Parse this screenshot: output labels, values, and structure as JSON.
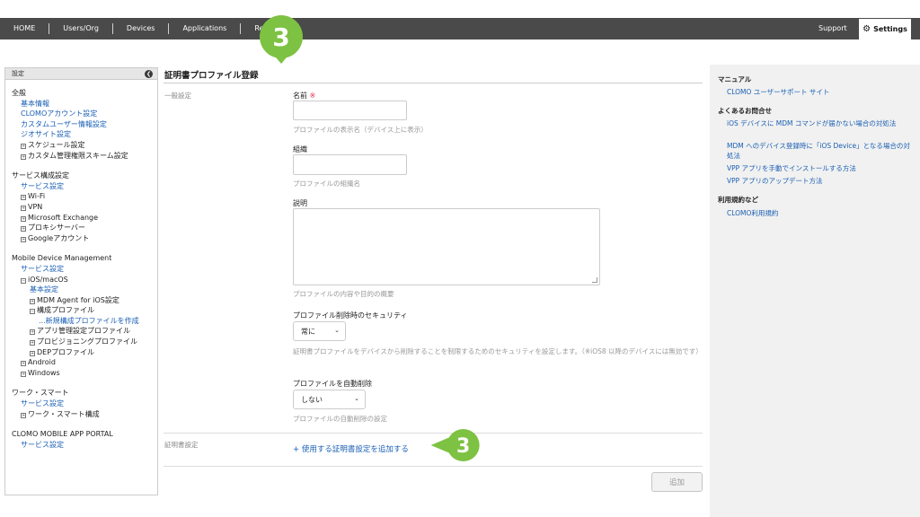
{
  "nav": {
    "items": [
      "HOME",
      "Users/Org",
      "Devices",
      "Applications",
      "Repor"
    ],
    "support": "Support",
    "settings": "Settings"
  },
  "sidebar": {
    "header": "設定",
    "sections": [
      {
        "title": "全般",
        "items": [
          {
            "label": "基本情報",
            "type": "link",
            "indent": 1
          },
          {
            "label": "CLOMOアカウント設定",
            "type": "link",
            "indent": 1
          },
          {
            "label": "カスタムユーザー情報設定",
            "type": "link",
            "indent": 1
          },
          {
            "label": "ジオサイト設定",
            "type": "link",
            "indent": 1
          },
          {
            "label": "スケジュール設定",
            "type": "plus",
            "indent": 1
          },
          {
            "label": "カスタム管理権限スキーム設定",
            "type": "plus",
            "indent": 1
          }
        ]
      },
      {
        "title": "サービス構成設定",
        "items": [
          {
            "label": "サービス設定",
            "type": "link",
            "indent": 1
          },
          {
            "label": "Wi-Fi",
            "type": "plus",
            "indent": 1
          },
          {
            "label": "VPN",
            "type": "plus",
            "indent": 1
          },
          {
            "label": "Microsoft Exchange",
            "type": "plus",
            "indent": 1
          },
          {
            "label": "プロキシサーバー",
            "type": "plus",
            "indent": 1
          },
          {
            "label": "Googleアカウント",
            "type": "plus",
            "indent": 1
          }
        ]
      },
      {
        "title": "Mobile Device Management",
        "items": [
          {
            "label": "サービス設定",
            "type": "link",
            "indent": 1
          },
          {
            "label": "iOS/macOS",
            "type": "minus",
            "indent": 1
          },
          {
            "label": "基本設定",
            "type": "link",
            "indent": 2
          },
          {
            "label": "MDM Agent for iOS設定",
            "type": "plus",
            "indent": 2
          },
          {
            "label": "構成プロファイル",
            "type": "minus",
            "indent": 2
          },
          {
            "label": "...新規構成プロファイルを作成",
            "type": "link",
            "indent": 3
          },
          {
            "label": "アプリ管理設定プロファイル",
            "type": "plus",
            "indent": 2
          },
          {
            "label": "プロビジョニングプロファイル",
            "type": "plus",
            "indent": 2
          },
          {
            "label": "DEPプロファイル",
            "type": "plus",
            "indent": 2
          },
          {
            "label": "Android",
            "type": "plus",
            "indent": 1
          },
          {
            "label": "Windows",
            "type": "plus",
            "indent": 1
          }
        ]
      },
      {
        "title": "ワーク・スマート",
        "items": [
          {
            "label": "サービス設定",
            "type": "link",
            "indent": 1
          },
          {
            "label": "ワーク・スマート構成",
            "type": "plus",
            "indent": 1
          }
        ]
      },
      {
        "title": "CLOMO MOBILE APP PORTAL",
        "items": [
          {
            "label": "サービス設定",
            "type": "link",
            "indent": 1
          }
        ]
      }
    ]
  },
  "main": {
    "title": "証明書プロファイル登録",
    "general_label": "一般設定",
    "name_label": "名前",
    "required_mark": "※",
    "name_value": "",
    "name_help": "プロファイルの表示名（デバイス上に表示）",
    "org_label": "組織",
    "org_value": "",
    "org_help": "プロファイルの組織名",
    "desc_label": "説明",
    "desc_value": "",
    "desc_help": "プロファイルの内容や目的の概要",
    "security_label": "プロファイル削除時のセキュリティ",
    "security_value": "常に",
    "security_help": "証明書プロファイルをデバイスから削除することを制限するためのセキュリティを設定します。（※iOS8 以降のデバイスには無効です）",
    "autodel_label": "プロファイルを自動削除",
    "autodel_value": "しない",
    "autodel_help": "プロファイルの自動削除の設定",
    "cert_label": "証明書設定",
    "add_cert_link": "+ 使用する証明書設定を追加する",
    "add_button": "追加"
  },
  "right": {
    "manual_heading": "マニュアル",
    "manual_link": "CLOMO ユーザーサポート サイト",
    "faq_heading": "よくあるお問合せ",
    "faq_links": [
      "iOS デバイスに MDM コマンドが届かない場合の対処法",
      "MDM へのデバイス登録時に「iOS Device」となる場合の対処法",
      "VPP アプリを手動でインストールする方法",
      "VPP アプリのアップデート方法"
    ],
    "terms_heading": "利用規約など",
    "terms_link": "CLOMO利用規約"
  },
  "badges": {
    "number": "3",
    "color": "#7dc242"
  }
}
